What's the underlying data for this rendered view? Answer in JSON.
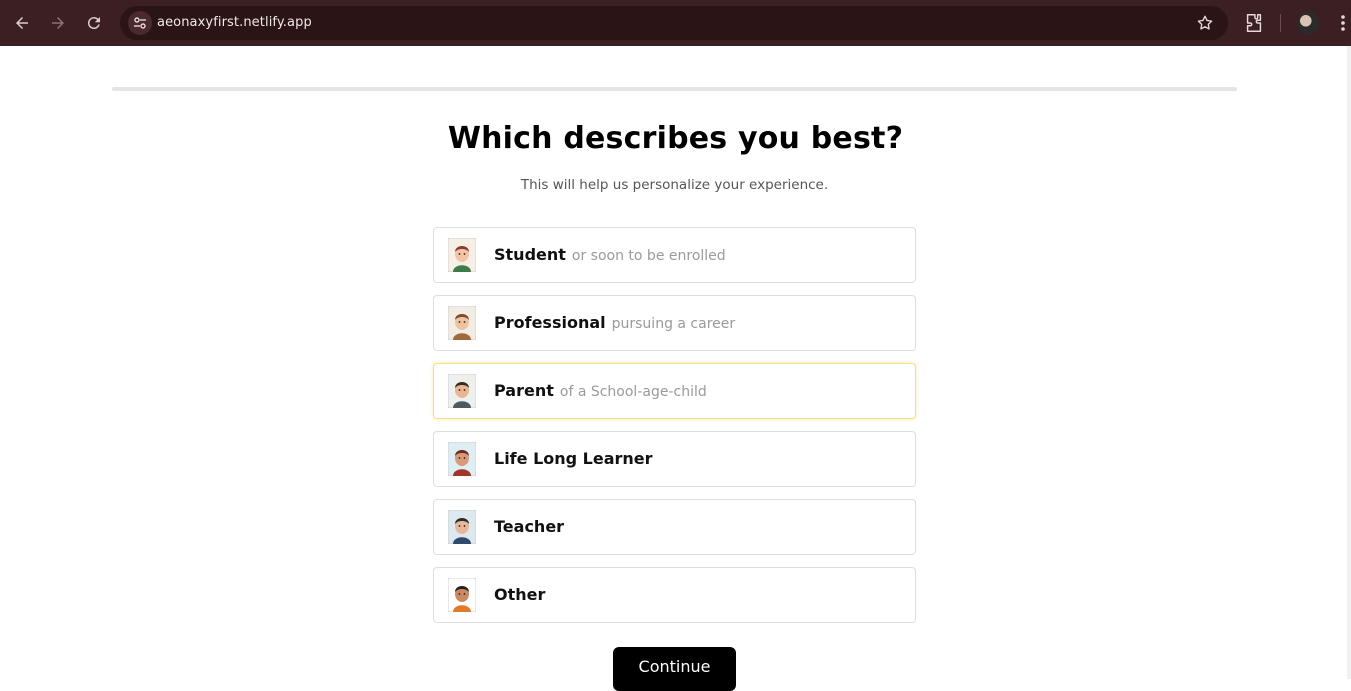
{
  "browser": {
    "url": "aeonaxyfirst.netlify.app"
  },
  "page": {
    "progress_percent": 0,
    "title": "Which describes you best?",
    "subtitle": "This will help us personalize your experience.",
    "options": [
      {
        "label": "Student",
        "hint": "or soon to be enrolled",
        "icon": "student-avatar-icon"
      },
      {
        "label": "Professional",
        "hint": "pursuing a career",
        "icon": "professional-avatar-icon"
      },
      {
        "label": "Parent",
        "hint": "of a School-age-child",
        "icon": "parent-avatar-icon",
        "selected": true
      },
      {
        "label": "Life Long Learner",
        "hint": "",
        "icon": "learner-avatar-icon"
      },
      {
        "label": "Teacher",
        "hint": "",
        "icon": "teacher-avatar-icon"
      },
      {
        "label": "Other",
        "hint": "",
        "icon": "other-avatar-icon"
      }
    ],
    "continue_label": "Continue"
  },
  "colors": {
    "chrome_bg": "#3b1f22",
    "selected_border": "#f3e08a",
    "button_bg": "#000000"
  }
}
